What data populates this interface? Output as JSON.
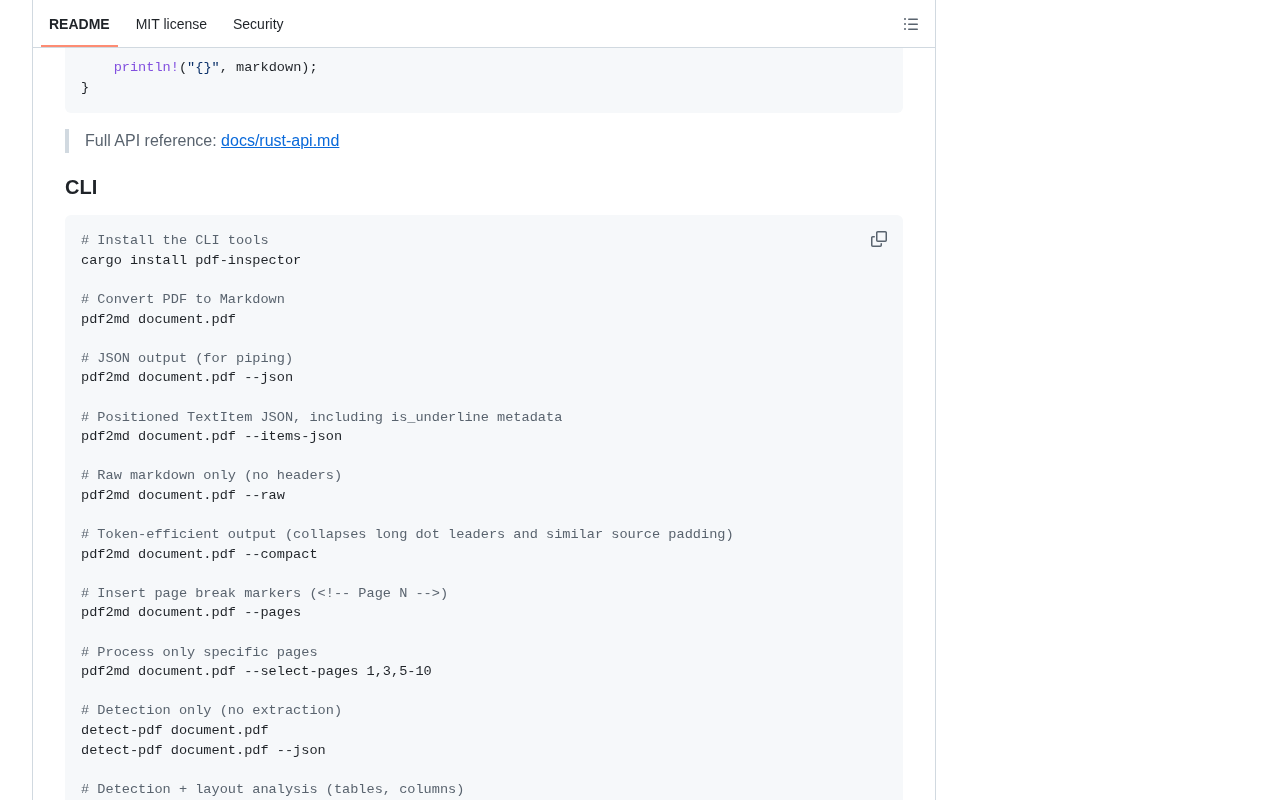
{
  "tabs": [
    {
      "label": "README",
      "selected": true
    },
    {
      "label": "MIT license",
      "selected": false
    },
    {
      "label": "Security",
      "selected": false
    }
  ],
  "rust_code": {
    "lines": [
      [
        {
          "kind": "function",
          "text": "    println!"
        },
        {
          "kind": "plain",
          "text": "("
        },
        {
          "kind": "string",
          "text": "\"{}\""
        },
        {
          "kind": "plain",
          "text": ", markdown);"
        }
      ],
      [
        {
          "kind": "plain",
          "text": "}"
        }
      ]
    ]
  },
  "blockquote": {
    "text": "Full API reference:",
    "link": "docs/rust-api.md"
  },
  "heading": "CLI",
  "cli_code": {
    "sections": [
      {
        "comment": "# Install the CLI tools",
        "commands": [
          "cargo install pdf-inspector"
        ]
      },
      {
        "comment": "# Convert PDF to Markdown",
        "commands": [
          "pdf2md document.pdf"
        ]
      },
      {
        "comment": "# JSON output (for piping)",
        "commands": [
          "pdf2md document.pdf --json"
        ]
      },
      {
        "comment": "# Positioned TextItem JSON, including is_underline metadata",
        "commands": [
          "pdf2md document.pdf --items-json"
        ]
      },
      {
        "comment": "# Raw markdown only (no headers)",
        "commands": [
          "pdf2md document.pdf --raw"
        ]
      },
      {
        "comment": "# Token-efficient output (collapses long dot leaders and similar source padding)",
        "commands": [
          "pdf2md document.pdf --compact"
        ]
      },
      {
        "comment": "# Insert page break markers (<!-- Page N -->)",
        "commands": [
          "pdf2md document.pdf --pages"
        ]
      },
      {
        "comment": "# Process only specific pages",
        "commands": [
          "pdf2md document.pdf --select-pages 1,3,5-10"
        ]
      },
      {
        "comment": "# Detection only (no extraction)",
        "commands": [
          "detect-pdf document.pdf",
          "detect-pdf document.pdf --json"
        ]
      },
      {
        "comment": "# Detection + layout analysis (tables, columns)"
      }
    ]
  }
}
